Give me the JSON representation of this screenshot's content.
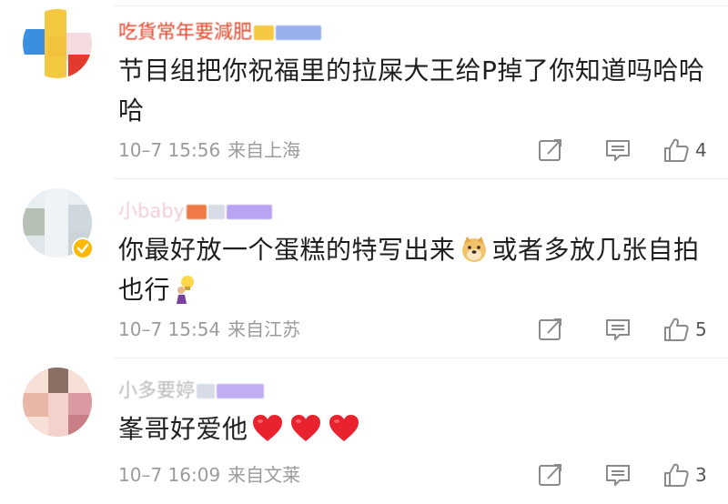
{
  "comments": [
    {
      "username": "吃貨常年要減肥",
      "text": "节目组把你祝福里的拉屎大王给P掉了你知道吗哈哈哈",
      "time": "10–7 15:56",
      "location": "来自上海",
      "likes": "4",
      "name_color": "#e0452b",
      "avatar_blocks": [
        "#f5c842",
        "#3c8ee0",
        "#e33a2e",
        "#f5dbe0",
        "#ffffff",
        "#f2c23b"
      ]
    },
    {
      "username": "小baby",
      "text_before": "你最好放一个蛋糕的特写出来",
      "text_middle": "或者多放几张自拍",
      "text_after": "也行",
      "time": "10–7 15:54",
      "location": "来自江苏",
      "likes": "5",
      "name_color": "#e8a0b4",
      "verified": true,
      "avatar_blocks": [
        "#dfe6ec",
        "#b7c0b5",
        "#f0f3f5",
        "#cfd8de",
        "#e8eef1",
        "#c9d3d8"
      ]
    },
    {
      "username": "小多要婷",
      "text": "峯哥好爱他",
      "time": "10–7 16:09",
      "location": "来自文莱",
      "likes": "3",
      "name_color": "#8a8a8a",
      "avatar_blocks": [
        "#8b6f64",
        "#e8b7a8",
        "#f7e0d6",
        "#d99aa2",
        "#c97e85",
        "#f3d2cc"
      ]
    }
  ],
  "icons": {
    "share": "share-icon",
    "reply": "comment-icon",
    "like": "thumbs-up-icon",
    "heart": "red-heart-emoji",
    "doge": "doge-emoji",
    "bulb": "bulb-person-emoji"
  },
  "colors": {
    "icon_gray": "#8a8a8a",
    "meta_gray": "#9b9b9b",
    "heart_red": "#e8232f"
  }
}
